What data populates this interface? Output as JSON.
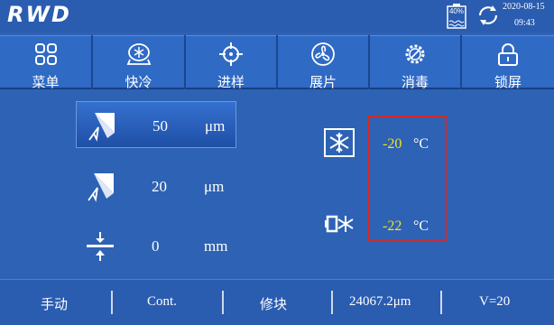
{
  "header": {
    "logo": "RWD",
    "battery": "40%",
    "date": "2020-08-15",
    "time": "09:43"
  },
  "toolbar": {
    "items": [
      {
        "label": "菜单",
        "icon": "menu-grid-icon"
      },
      {
        "label": "快冷",
        "icon": "fast-cool-icon"
      },
      {
        "label": "进样",
        "icon": "target-icon"
      },
      {
        "label": "展片",
        "icon": "fan-icon"
      },
      {
        "label": "消毒",
        "icon": "disinfect-gear-icon"
      },
      {
        "label": "锁屏",
        "icon": "lock-icon"
      }
    ]
  },
  "settings": {
    "rows": [
      {
        "value": "50",
        "unit": "μm",
        "icon": "section-thickness-icon",
        "selected": true
      },
      {
        "value": "20",
        "unit": "μm",
        "icon": "trim-thickness-icon",
        "selected": false
      },
      {
        "value": "0",
        "unit": "mm",
        "icon": "retraction-icon",
        "selected": false
      }
    ]
  },
  "temperatures": {
    "chamber": {
      "value": "-20",
      "unit": "°C",
      "icon": "snowflake-icon"
    },
    "specimen": {
      "value": "-22",
      "unit": "°C",
      "icon": "specimen-cooling-icon"
    }
  },
  "status": {
    "mode": "手动",
    "cut_mode": "Cont.",
    "operation": "修块",
    "position": "24067.2μm",
    "speed": "V=20"
  },
  "colors": {
    "background": "#2d62b4",
    "temperature_value": "#f2e31f",
    "highlight_border": "#d42a2a"
  }
}
